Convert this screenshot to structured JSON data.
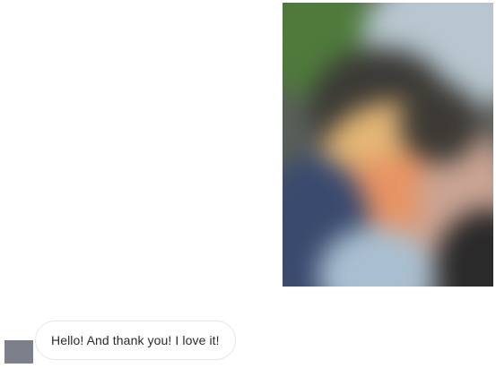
{
  "messages": [
    {
      "type": "photo",
      "direction": "outgoing"
    },
    {
      "type": "text",
      "direction": "incoming",
      "text": "Hello! And thank you! I love it!",
      "avatar_color": "#7d7f8a"
    }
  ]
}
